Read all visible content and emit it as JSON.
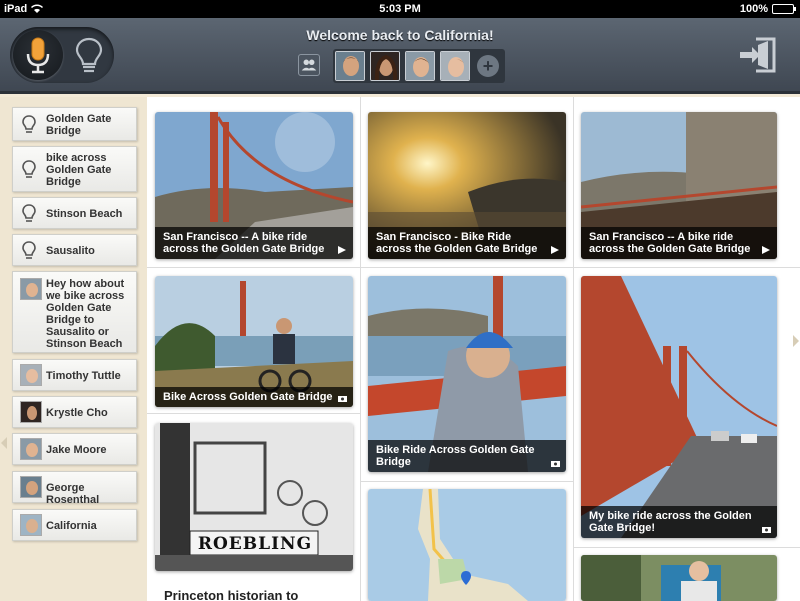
{
  "status": {
    "carrier": "iPad",
    "time": "5:03 PM",
    "battery": "100%"
  },
  "header": {
    "welcome": "Welcome back to California!",
    "add_label": "+"
  },
  "sidebar": {
    "items": [
      {
        "type": "idea",
        "label": "Golden Gate Bridge"
      },
      {
        "type": "idea",
        "label": "bike across Golden Gate Bridge"
      },
      {
        "type": "idea",
        "label": "Stinson Beach"
      },
      {
        "type": "idea",
        "label": "Sausalito"
      },
      {
        "type": "message",
        "label": "Hey how about we bike across Golden Gate Bridge to Sausalito or Stinson Beach"
      },
      {
        "type": "person",
        "label": "Timothy Tuttle"
      },
      {
        "type": "person",
        "label": "Krystle Cho"
      },
      {
        "type": "person",
        "label": "Jake Moore"
      },
      {
        "type": "person",
        "label": "George Rosenthal"
      },
      {
        "type": "place",
        "label": "California"
      }
    ]
  },
  "cards": [
    {
      "caption": "San Francisco -- A bike ride across the Golden Gate Bridge",
      "kind": "video"
    },
    {
      "caption": "San Francisco - Bike Ride across the Golden Gate Bridge",
      "kind": "video"
    },
    {
      "caption": "San Francisco -- A bike ride across the Golden Gate Bridge",
      "kind": "video"
    },
    {
      "caption": "Bike Across Golden Gate Bridge",
      "kind": "photo"
    },
    {
      "caption": "Bike Ride Across Golden Gate Bridge",
      "kind": "photo"
    },
    {
      "caption": "My bike ride across the Golden Gate Bridge!",
      "kind": "photo"
    },
    {
      "sign": "ROEBLING"
    }
  ],
  "article": {
    "title": "Princeton historian to"
  },
  "colors": {
    "header": "#4a535e",
    "sidebar_bg": "#efe6d2",
    "mic_accent": "#f2a23a"
  }
}
